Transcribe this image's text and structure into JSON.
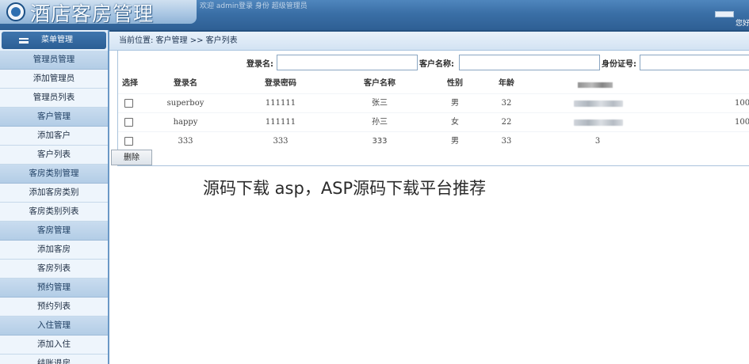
{
  "header": {
    "title": "酒店客房管理",
    "welcome_text": "欢迎 admin登录 身份 超级管理员",
    "top_right_text": "您好"
  },
  "sidebar": {
    "menu_title": "菜单管理",
    "items": [
      {
        "label": "管理员管理",
        "type": "group"
      },
      {
        "label": "添加管理员",
        "type": "sub"
      },
      {
        "label": "管理员列表",
        "type": "sub"
      },
      {
        "label": "客户管理",
        "type": "group"
      },
      {
        "label": "添加客户",
        "type": "sub"
      },
      {
        "label": "客户列表",
        "type": "sub"
      },
      {
        "label": "客房类别管理",
        "type": "group"
      },
      {
        "label": "添加客房类别",
        "type": "sub"
      },
      {
        "label": "客房类别列表",
        "type": "sub"
      },
      {
        "label": "客房管理",
        "type": "group"
      },
      {
        "label": "添加客房",
        "type": "sub"
      },
      {
        "label": "客房列表",
        "type": "sub"
      },
      {
        "label": "预约管理",
        "type": "group"
      },
      {
        "label": "预约列表",
        "type": "sub"
      },
      {
        "label": "入住管理",
        "type": "group"
      },
      {
        "label": "添加入住",
        "type": "sub"
      },
      {
        "label": "结账退房",
        "type": "sub"
      }
    ]
  },
  "breadcrumb": "当前位置: 客户管理 >> 客户列表",
  "search": {
    "login_label": "登录名:",
    "login_value": "",
    "name_label": "客户名称:",
    "name_value": "",
    "id_label": "身份证号:",
    "id_value": ""
  },
  "table": {
    "headers": [
      "选择",
      "登录名",
      "登录密码",
      "客户名称",
      "性别",
      "年龄",
      "",
      ""
    ],
    "rows": [
      {
        "login": "superboy",
        "password": "111111",
        "name": "张三",
        "gender": "男",
        "age": "32",
        "id_number": "",
        "tail": "100"
      },
      {
        "login": "happy",
        "password": "111111",
        "name": "孙三",
        "gender": "女",
        "age": "22",
        "id_number": "",
        "tail": "100"
      },
      {
        "login": "333",
        "password": "333",
        "name": "333",
        "gender": "男",
        "age": "33",
        "id_number": "3",
        "tail": ""
      }
    ]
  },
  "delete_label": "删除",
  "caption": "源码下载 asp，ASP源码下载平台推荐",
  "colors": {
    "banner": "#3a6fa6",
    "menu_group": "#b3cde6",
    "menu_sub": "#eef5fc",
    "breadcrumb": "#d3e3f3"
  }
}
